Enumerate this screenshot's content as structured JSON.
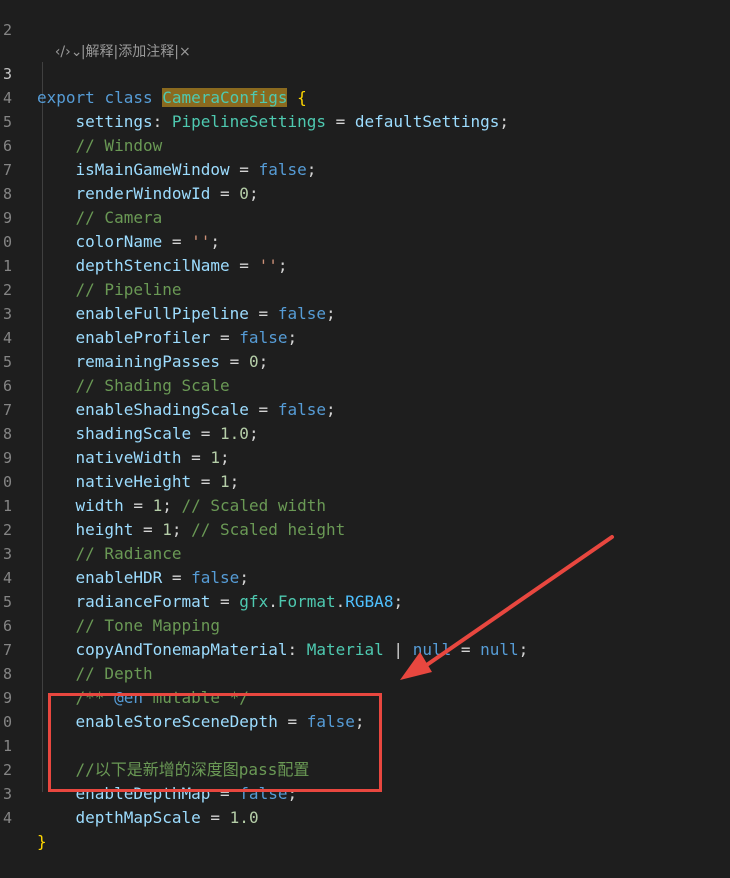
{
  "codelens": {
    "icon": "code-icon",
    "explain": "解释",
    "add_comment": "添加注释",
    "close": "×",
    "sep": "|"
  },
  "lines": [
    {
      "n": "2"
    },
    {
      "n": "3"
    },
    {
      "n": "4"
    },
    {
      "n": "5"
    },
    {
      "n": "6"
    },
    {
      "n": "7"
    },
    {
      "n": "8"
    },
    {
      "n": "9"
    },
    {
      "n": "0"
    },
    {
      "n": "1"
    },
    {
      "n": "2"
    },
    {
      "n": "3"
    },
    {
      "n": "4"
    },
    {
      "n": "5"
    },
    {
      "n": "6"
    },
    {
      "n": "7"
    },
    {
      "n": "8"
    },
    {
      "n": "9"
    },
    {
      "n": "0"
    },
    {
      "n": "1"
    },
    {
      "n": "2"
    },
    {
      "n": "3"
    },
    {
      "n": "4"
    },
    {
      "n": "5"
    },
    {
      "n": "6"
    },
    {
      "n": "7"
    },
    {
      "n": "8"
    },
    {
      "n": "9"
    },
    {
      "n": "0"
    },
    {
      "n": "1"
    },
    {
      "n": "2"
    },
    {
      "n": "3"
    },
    {
      "n": "4"
    }
  ],
  "code": {
    "l3_export": "export",
    "l3_class": "class",
    "l3_name": "CameraConfigs",
    "l3_brace": "{",
    "l4_prop": "settings",
    "l4_type": "PipelineSettings",
    "l4_val": "defaultSettings",
    "l5": "// Window",
    "l6_prop": "isMainGameWindow",
    "l6_val": "false",
    "l7_prop": "renderWindowId",
    "l7_val": "0",
    "l8": "// Camera",
    "l9_prop": "colorName",
    "l9_val": "''",
    "l10_prop": "depthStencilName",
    "l10_val": "''",
    "l11": "// Pipeline",
    "l12_prop": "enableFullPipeline",
    "l12_val": "false",
    "l13_prop": "enableProfiler",
    "l13_val": "false",
    "l14_prop": "remainingPasses",
    "l14_val": "0",
    "l15": "// Shading Scale",
    "l16_prop": "enableShadingScale",
    "l16_val": "false",
    "l17_prop": "shadingScale",
    "l17_val": "1.0",
    "l18_prop": "nativeWidth",
    "l18_val": "1",
    "l19_prop": "nativeHeight",
    "l19_val": "1",
    "l20_prop": "width",
    "l20_val": "1",
    "l20_cmt": "// Scaled width",
    "l21_prop": "height",
    "l21_val": "1",
    "l21_cmt": "// Scaled height",
    "l22": "// Radiance",
    "l23_prop": "enableHDR",
    "l23_val": "false",
    "l24_prop": "radianceFormat",
    "l24_ns": "gfx",
    "l24_cls": "Format",
    "l24_val": "RGBA8",
    "l25": "// Tone Mapping",
    "l26_prop": "copyAndTonemapMaterial",
    "l26_type": "Material",
    "l26_null1": "null",
    "l26_null2": "null",
    "l27": "// Depth",
    "l28_a": "/** ",
    "l28_tag": "@en",
    "l28_b": " mutable */",
    "l29_prop": "enableStoreSceneDepth",
    "l29_val": "false",
    "l31": "//以下是新增的深度图pass配置",
    "l32_prop": "enableDepthMap",
    "l32_val": "false",
    "l33_prop": "depthMapScale",
    "l33_val": "1.0",
    "l34": "}"
  },
  "colors": {
    "annotation": "#e8473f",
    "background": "#1e1e1e"
  }
}
